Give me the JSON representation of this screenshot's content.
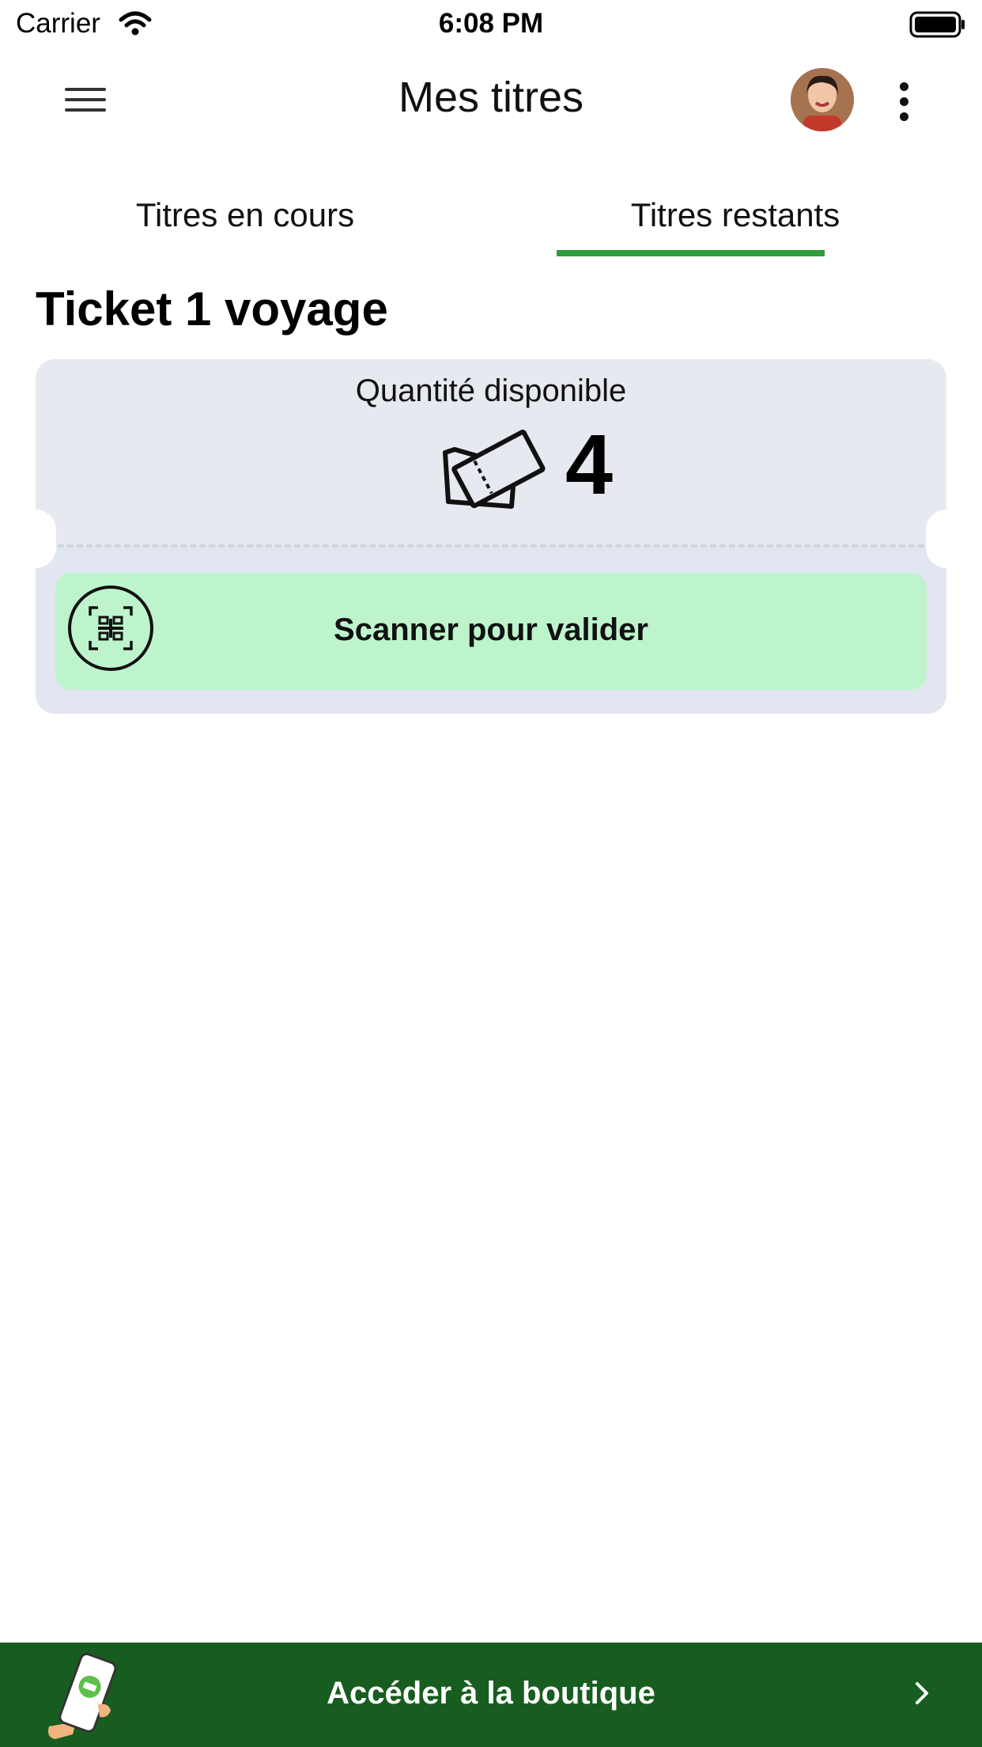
{
  "status_bar": {
    "carrier": "Carrier",
    "time": "6:08 PM"
  },
  "nav": {
    "title": "Mes titres"
  },
  "tabs": [
    {
      "label": "Titres en cours",
      "active": false
    },
    {
      "label": "Titres restants",
      "active": true
    }
  ],
  "section": {
    "title": "Ticket 1 voyage"
  },
  "ticket": {
    "quantity_label": "Quantité disponible",
    "quantity_value": "4",
    "scan_label": "Scanner pour valider"
  },
  "shop": {
    "label": "Accéder à la boutique"
  },
  "colors": {
    "accent_green": "#2e9c3a",
    "shop_bar": "#185d20",
    "scan_button": "#bdf4cc",
    "card_bg": "#e7e9f0"
  },
  "icons": [
    "wifi-icon",
    "battery-icon",
    "menu-icon",
    "avatar",
    "more-icon",
    "ticket-icon",
    "qr-scan-icon",
    "phone-illustration",
    "chevron-right-icon"
  ]
}
